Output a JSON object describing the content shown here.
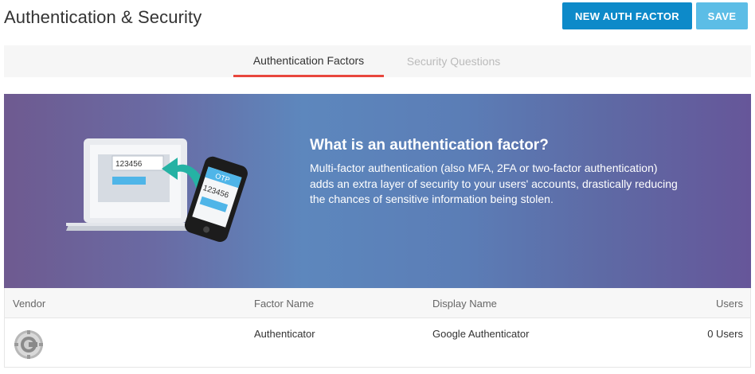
{
  "header": {
    "title": "Authentication & Security",
    "new_button": "NEW AUTH FACTOR",
    "save_button": "SAVE"
  },
  "tabs": [
    {
      "label": "Authentication Factors",
      "active": true
    },
    {
      "label": "Security Questions",
      "active": false
    }
  ],
  "banner": {
    "heading": "What is an authentication factor?",
    "text": "Multi-factor authentication (also MFA, 2FA or two-factor authentication) adds an extra layer of security to your users' accounts, drastically reducing the chances of sensitive information being stolen.",
    "illustration": {
      "laptop_code": "123456",
      "phone_label": "OTP",
      "phone_code": "123456"
    }
  },
  "table": {
    "columns": [
      "Vendor",
      "Factor Name",
      "Display Name",
      "Users"
    ],
    "rows": [
      {
        "vendor_icon": "google-authenticator-logo",
        "factor_name": "Authenticator",
        "display_name": "Google Authenticator",
        "users": "0 Users"
      }
    ]
  },
  "colors": {
    "primary_button": "#0d8ac9",
    "save_button": "#5cbde6",
    "active_tab_underline": "#e8463d"
  }
}
